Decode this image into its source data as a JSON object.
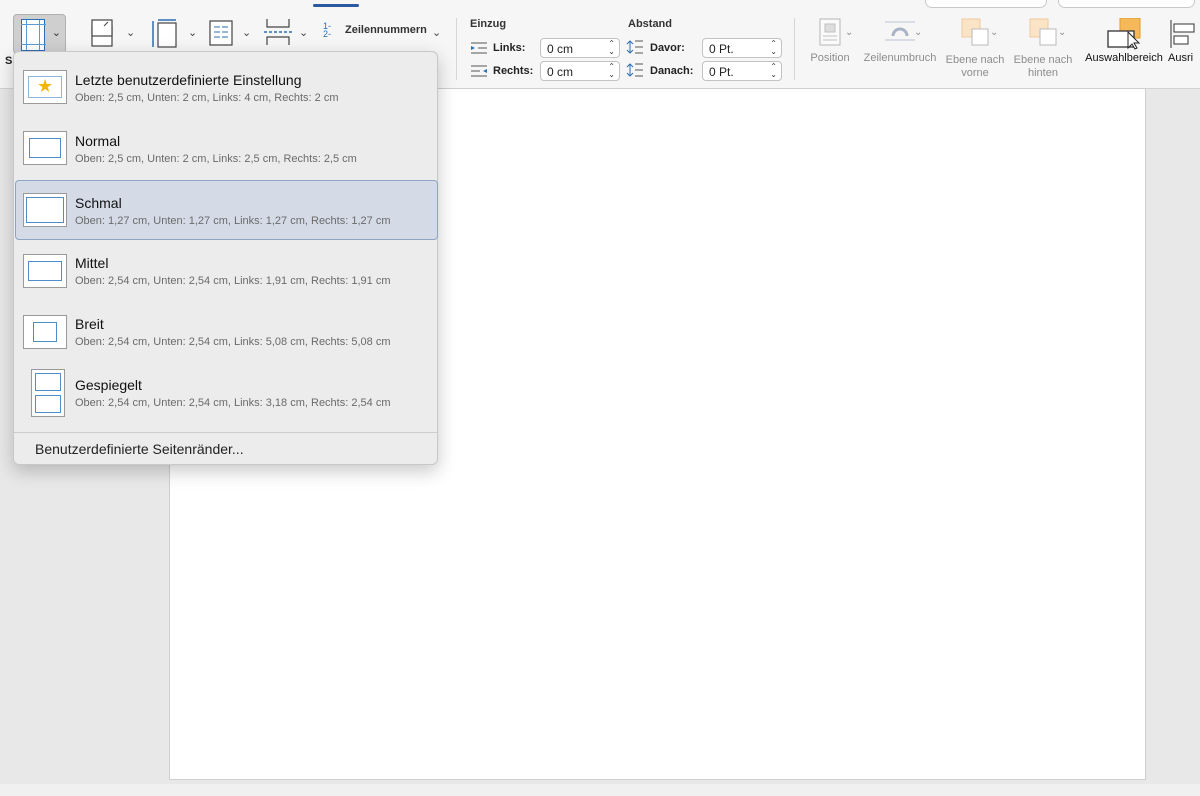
{
  "ribbon": {
    "margins_label_partial": "S",
    "line_numbers_label": "Zeilennummern",
    "indent": {
      "title": "Einzug",
      "left_label": "Links:",
      "left_value": "0 cm",
      "right_label": "Rechts:",
      "right_value": "0 cm"
    },
    "spacing": {
      "title": "Abstand",
      "before_label": "Davor:",
      "before_value": "0 Pt.",
      "after_label": "Danach:",
      "after_value": "0 Pt."
    },
    "arrange": [
      {
        "label": "Position",
        "enabled": false
      },
      {
        "label": "Zeilenumbruch",
        "enabled": false
      },
      {
        "label": "Ebene nach vorne",
        "enabled": false
      },
      {
        "label": "Ebene nach hinten",
        "enabled": false
      },
      {
        "label": "Auswahlbereich",
        "enabled": true
      },
      {
        "label": "Ausri",
        "enabled": true
      }
    ]
  },
  "margins_menu": {
    "items": [
      {
        "title": "Letzte benutzerdefinierte Einstellung",
        "desc": "Oben: 2,5 cm, Unten: 2 cm, Links: 4 cm, Rechts: 2 cm",
        "icon": "star-icon",
        "selected": false
      },
      {
        "title": "Normal",
        "desc": "Oben: 2,5 cm, Unten: 2 cm, Links: 2,5 cm, Rechts: 2,5 cm",
        "icon": "margin-normal-icon",
        "selected": false
      },
      {
        "title": "Schmal",
        "desc": "Oben: 1,27 cm, Unten: 1,27 cm, Links: 1,27 cm, Rechts: 1,27 cm",
        "icon": "margin-narrow-icon",
        "selected": true
      },
      {
        "title": "Mittel",
        "desc": "Oben: 2,54 cm, Unten: 2,54 cm, Links: 1,91 cm, Rechts: 1,91 cm",
        "icon": "margin-moderate-icon",
        "selected": false
      },
      {
        "title": "Breit",
        "desc": "Oben: 2,54 cm, Unten: 2,54 cm, Links: 5,08 cm, Rechts: 5,08 cm",
        "icon": "margin-wide-icon",
        "selected": false
      },
      {
        "title": "Gespiegelt",
        "desc": "Oben: 2,54 cm, Unten: 2,54 cm, Links: 3,18 cm, Rechts: 2,54 cm",
        "icon": "margin-mirrored-icon",
        "selected": false
      }
    ],
    "custom_label": "Benutzerdefinierte Seitenränder..."
  },
  "colors": {
    "accent": "#2c6fb5",
    "selection": "#d4dbe7",
    "star": "#f2b705",
    "disabled_text": "#8d8d8d"
  }
}
